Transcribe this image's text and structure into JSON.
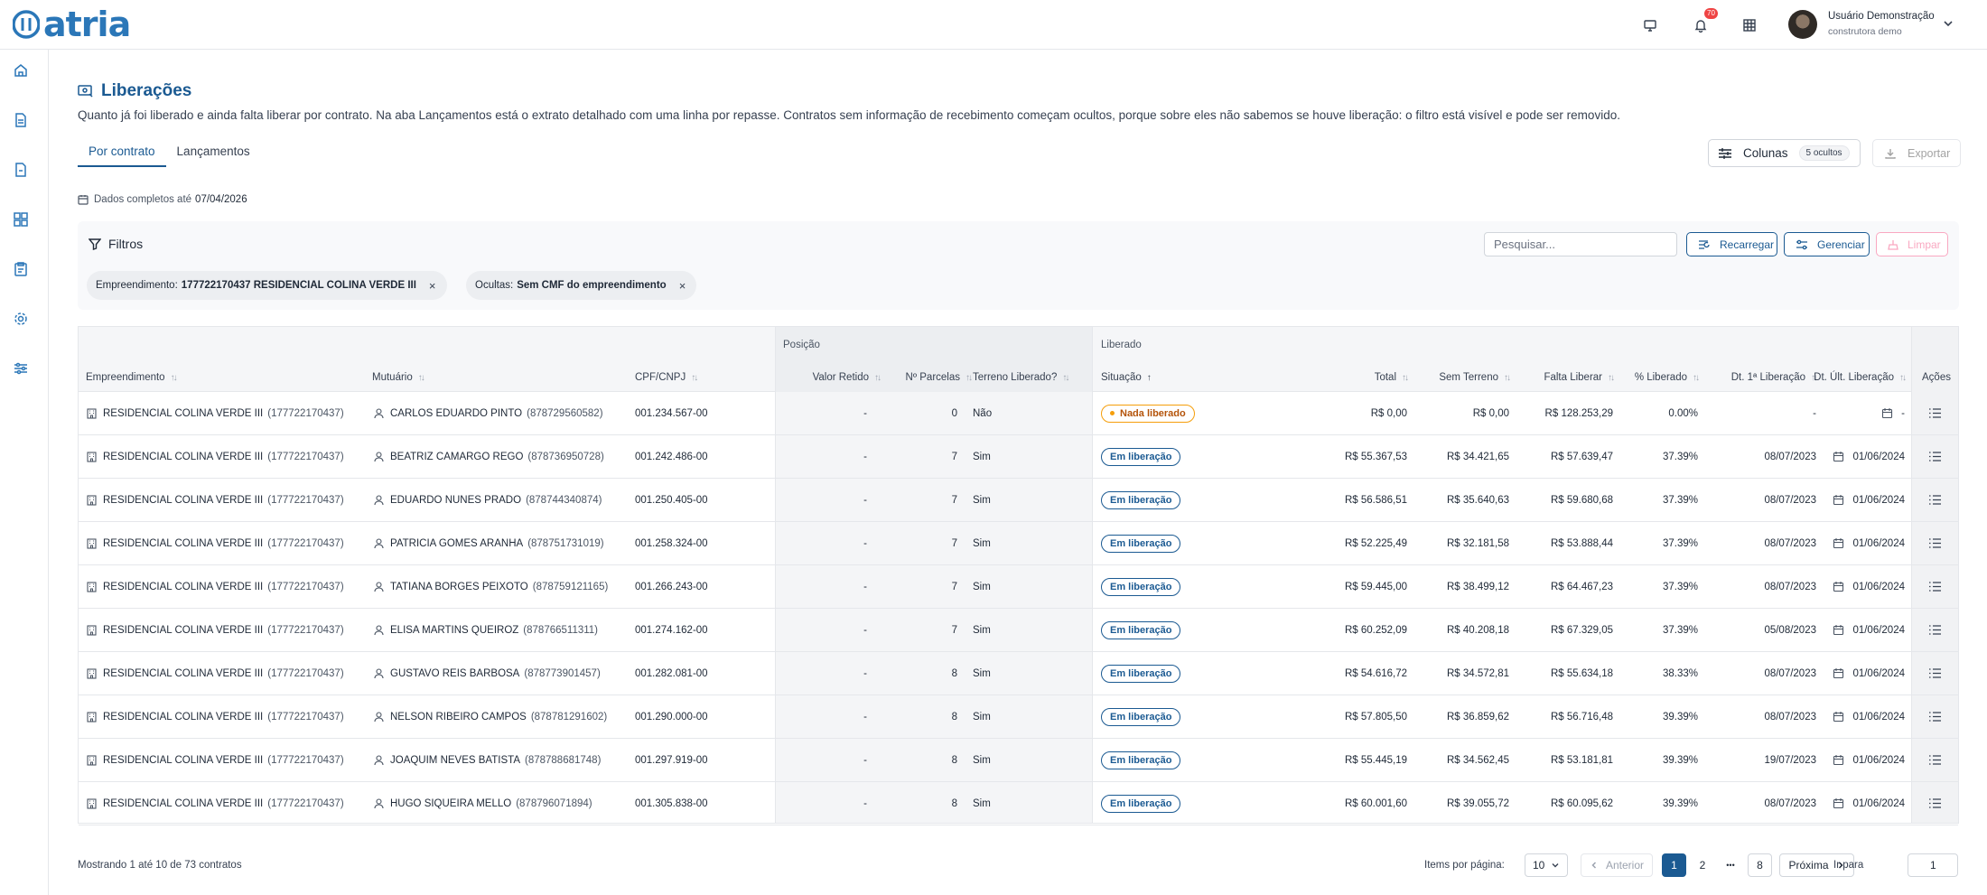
{
  "app": {
    "logo_text": "atria"
  },
  "header": {
    "notifications_count": "70",
    "user_name": "Usuário Demonstração",
    "user_org": "construtora demo"
  },
  "sidebar": {
    "items": [
      {
        "icon": "home-icon"
      },
      {
        "icon": "document-icon"
      },
      {
        "icon": "file-icon"
      },
      {
        "icon": "dashboard-icon"
      },
      {
        "icon": "clipboard-icon"
      },
      {
        "icon": "gear-icon"
      },
      {
        "icon": "sliders-icon"
      }
    ]
  },
  "page": {
    "title": "Liberações",
    "description": "Quanto já foi liberado e ainda falta liberar por contrato. Na aba Lançamentos está o extrato detalhado com uma linha por repasse. Contratos sem informação de recebimento começam ocultos, porque sobre eles não sabemos se houve liberação: o filtro está visível e pode ser removido.",
    "tabs": [
      {
        "label": "Por contrato",
        "active": true
      },
      {
        "label": "Lançamentos",
        "active": false
      }
    ],
    "columns_button": "Colunas",
    "hidden_count": "5 ocultos",
    "export_button": "Exportar",
    "data_date_label": "Dados completos até",
    "data_date": "07/04/2026"
  },
  "filters": {
    "title": "Filtros",
    "search_placeholder": "Pesquisar...",
    "reload": "Recarregar",
    "manage": "Gerenciar",
    "clear": "Limpar",
    "chips": [
      {
        "label": "Empreendimento:",
        "value": "177722170437 RESIDENCIAL COLINA VERDE III"
      },
      {
        "label": "Ocultas:",
        "value": "Sem CMF do empreendimento"
      }
    ]
  },
  "table": {
    "groups": {
      "posicao": "Posição",
      "liberado": "Liberado"
    },
    "columns": {
      "empreendimento": "Empreendimento",
      "mutuario": "Mutuário",
      "cpf": "CPF/CNPJ",
      "valor_retido": "Valor Retido",
      "parcelas": "Nº Parcelas",
      "terreno": "Terreno Liberado?",
      "situacao": "Situação",
      "total": "Total",
      "sem_terreno": "Sem Terreno",
      "falta": "Falta Liberar",
      "pct": "% Liberado",
      "dt_primeira": "Dt. 1ª Liberação",
      "dt_ultima": "Dt. Últ. Liberação",
      "acoes": "Ações"
    },
    "rows": [
      {
        "emp": "RESIDENCIAL COLINA VERDE III",
        "emp_code": "(177722170437)",
        "mutuario": "CARLOS EDUARDO PINTO",
        "mut_code": "(878729560582)",
        "cpf": "001.234.567-00",
        "retido": "-",
        "parcelas": "0",
        "terreno": "Não",
        "situacao": "Nada liberado",
        "situacao_type": "warn",
        "total": "R$ 0,00",
        "sem_terreno": "R$ 0,00",
        "falta": "R$ 128.253,29",
        "pct": "0.00%",
        "dt1": "-",
        "dtu": "-"
      },
      {
        "emp": "RESIDENCIAL COLINA VERDE III",
        "emp_code": "(177722170437)",
        "mutuario": "BEATRIZ CAMARGO REGO",
        "mut_code": "(878736950728)",
        "cpf": "001.242.486-00",
        "retido": "-",
        "parcelas": "7",
        "terreno": "Sim",
        "situacao": "Em liberação",
        "situacao_type": "info",
        "total": "R$ 55.367,53",
        "sem_terreno": "R$ 34.421,65",
        "falta": "R$ 57.639,47",
        "pct": "37.39%",
        "dt1": "08/07/2023",
        "dtu": "01/06/2024"
      },
      {
        "emp": "RESIDENCIAL COLINA VERDE III",
        "emp_code": "(177722170437)",
        "mutuario": "EDUARDO NUNES PRADO",
        "mut_code": "(878744340874)",
        "cpf": "001.250.405-00",
        "retido": "-",
        "parcelas": "7",
        "terreno": "Sim",
        "situacao": "Em liberação",
        "situacao_type": "info",
        "total": "R$ 56.586,51",
        "sem_terreno": "R$ 35.640,63",
        "falta": "R$ 59.680,68",
        "pct": "37.39%",
        "dt1": "08/07/2023",
        "dtu": "01/06/2024"
      },
      {
        "emp": "RESIDENCIAL COLINA VERDE III",
        "emp_code": "(177722170437)",
        "mutuario": "PATRICIA GOMES ARANHA",
        "mut_code": "(878751731019)",
        "cpf": "001.258.324-00",
        "retido": "-",
        "parcelas": "7",
        "terreno": "Sim",
        "situacao": "Em liberação",
        "situacao_type": "info",
        "total": "R$ 52.225,49",
        "sem_terreno": "R$ 32.181,58",
        "falta": "R$ 53.888,44",
        "pct": "37.39%",
        "dt1": "08/07/2023",
        "dtu": "01/06/2024"
      },
      {
        "emp": "RESIDENCIAL COLINA VERDE III",
        "emp_code": "(177722170437)",
        "mutuario": "TATIANA BORGES PEIXOTO",
        "mut_code": "(878759121165)",
        "cpf": "001.266.243-00",
        "retido": "-",
        "parcelas": "7",
        "terreno": "Sim",
        "situacao": "Em liberação",
        "situacao_type": "info",
        "total": "R$ 59.445,00",
        "sem_terreno": "R$ 38.499,12",
        "falta": "R$ 64.467,23",
        "pct": "37.39%",
        "dt1": "08/07/2023",
        "dtu": "01/06/2024"
      },
      {
        "emp": "RESIDENCIAL COLINA VERDE III",
        "emp_code": "(177722170437)",
        "mutuario": "ELISA MARTINS QUEIROZ",
        "mut_code": "(878766511311)",
        "cpf": "001.274.162-00",
        "retido": "-",
        "parcelas": "7",
        "terreno": "Sim",
        "situacao": "Em liberação",
        "situacao_type": "info",
        "total": "R$ 60.252,09",
        "sem_terreno": "R$ 40.208,18",
        "falta": "R$ 67.329,05",
        "pct": "37.39%",
        "dt1": "05/08/2023",
        "dtu": "01/06/2024"
      },
      {
        "emp": "RESIDENCIAL COLINA VERDE III",
        "emp_code": "(177722170437)",
        "mutuario": "GUSTAVO REIS BARBOSA",
        "mut_code": "(878773901457)",
        "cpf": "001.282.081-00",
        "retido": "-",
        "parcelas": "8",
        "terreno": "Sim",
        "situacao": "Em liberação",
        "situacao_type": "info",
        "total": "R$ 54.616,72",
        "sem_terreno": "R$ 34.572,81",
        "falta": "R$ 55.634,18",
        "pct": "38.33%",
        "dt1": "08/07/2023",
        "dtu": "01/06/2024"
      },
      {
        "emp": "RESIDENCIAL COLINA VERDE III",
        "emp_code": "(177722170437)",
        "mutuario": "NELSON RIBEIRO CAMPOS",
        "mut_code": "(878781291602)",
        "cpf": "001.290.000-00",
        "retido": "-",
        "parcelas": "8",
        "terreno": "Sim",
        "situacao": "Em liberação",
        "situacao_type": "info",
        "total": "R$ 57.805,50",
        "sem_terreno": "R$ 36.859,62",
        "falta": "R$ 56.716,48",
        "pct": "39.39%",
        "dt1": "08/07/2023",
        "dtu": "01/06/2024"
      },
      {
        "emp": "RESIDENCIAL COLINA VERDE III",
        "emp_code": "(177722170437)",
        "mutuario": "JOAQUIM NEVES BATISTA",
        "mut_code": "(878788681748)",
        "cpf": "001.297.919-00",
        "retido": "-",
        "parcelas": "8",
        "terreno": "Sim",
        "situacao": "Em liberação",
        "situacao_type": "info",
        "total": "R$ 55.445,19",
        "sem_terreno": "R$ 34.562,45",
        "falta": "R$ 53.181,81",
        "pct": "39.39%",
        "dt1": "19/07/2023",
        "dtu": "01/06/2024"
      },
      {
        "emp": "RESIDENCIAL COLINA VERDE III",
        "emp_code": "(177722170437)",
        "mutuario": "HUGO SIQUEIRA MELLO",
        "mut_code": "(878796071894)",
        "cpf": "001.305.838-00",
        "retido": "-",
        "parcelas": "8",
        "terreno": "Sim",
        "situacao": "Em liberação",
        "situacao_type": "info",
        "total": "R$ 60.001,60",
        "sem_terreno": "R$ 39.055,72",
        "falta": "R$ 60.095,62",
        "pct": "39.39%",
        "dt1": "08/07/2023",
        "dtu": "01/06/2024"
      }
    ]
  },
  "footer": {
    "showing": "Mostrando 1 até 10 de 73 contratos",
    "per_page_label": "Items por página:",
    "per_page": "10",
    "prev": "Anterior",
    "pages": [
      "1",
      "2",
      "8"
    ],
    "ellipsis": "•••",
    "next": "Próxima",
    "goto_label": "Ir para",
    "goto_value": "1"
  },
  "colors": {
    "primary": "#1b5a92",
    "logo": "#2b77b8",
    "warn": "#f59e0b",
    "danger": "#ef4444"
  }
}
